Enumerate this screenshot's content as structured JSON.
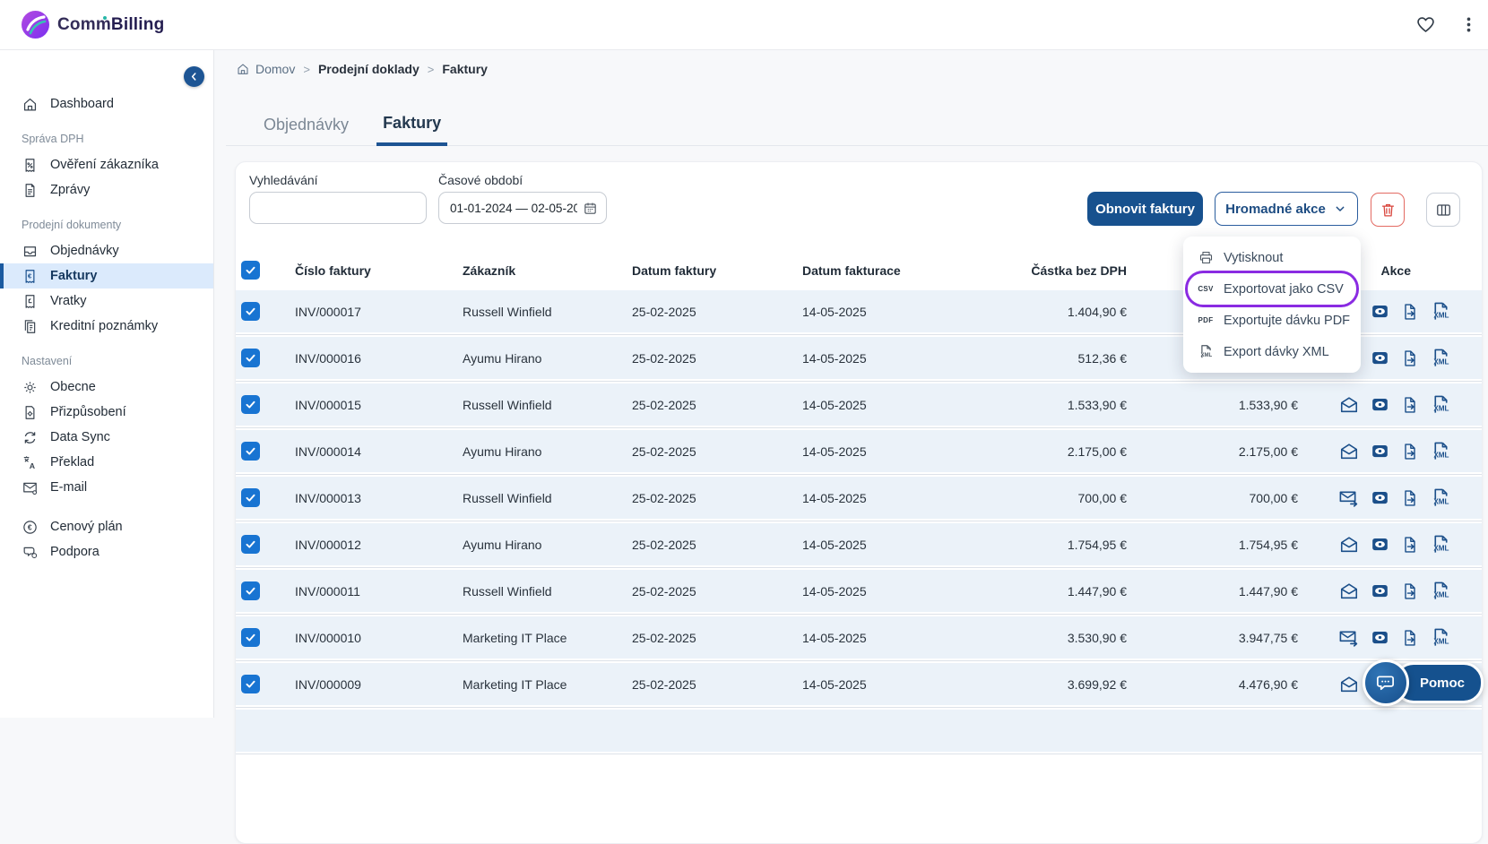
{
  "colors": {
    "primary": "#17518E",
    "highlight_purple": "#8A2BE2",
    "row_bg": "#EBF2F9",
    "checkbox_blue": "#1874D2",
    "danger_red": "#D8453C",
    "active_item_bg": "#DBEAFC",
    "icon_navy": "#1B4F8A"
  },
  "topbar": {
    "brand_comm": "Comm",
    "brand_billing": "Billing"
  },
  "sidebar": {
    "groups": [
      {
        "items": [
          {
            "label": "Dashboard",
            "icon": "home-icon"
          }
        ]
      },
      {
        "label": "Správa DPH",
        "items": [
          {
            "label": "Ověření zákazníka",
            "icon": "receipt-percent-icon"
          },
          {
            "label": "Zprávy",
            "icon": "document-icon"
          }
        ]
      },
      {
        "label": "Prodejní dokumenty",
        "items": [
          {
            "label": "Objednávky",
            "icon": "inbox-icon"
          },
          {
            "label": "Faktury",
            "icon": "receipt-euro-icon",
            "active": true
          },
          {
            "label": "Vratky",
            "icon": "receipt-return-icon"
          },
          {
            "label": "Kreditní poznámky",
            "icon": "copy-icon"
          }
        ]
      },
      {
        "label": "Nastavení",
        "items": [
          {
            "label": "Obecne",
            "icon": "gear-icon"
          },
          {
            "label": "Přizpůsobení",
            "icon": "document-gear-icon"
          },
          {
            "label": "Data Sync",
            "icon": "sync-icon"
          },
          {
            "label": "Překlad",
            "icon": "translate-icon"
          },
          {
            "label": "E-mail",
            "icon": "mail-gear-icon"
          }
        ]
      },
      {
        "items": [
          {
            "label": "Cenový plán",
            "icon": "euro-circle-icon"
          },
          {
            "label": "Podpora",
            "icon": "support-icon"
          }
        ]
      }
    ]
  },
  "breadcrumb": {
    "items": [
      "Domov",
      "Prodejní doklady",
      "Faktury"
    ]
  },
  "tabs": [
    {
      "label": "Objednávky",
      "active": false
    },
    {
      "label": "Faktury",
      "active": true
    }
  ],
  "filters": {
    "search_label": "Vyhledávání",
    "search_value": "",
    "period_label": "Časové období",
    "period_value": "01-01-2024 — 02-05-202"
  },
  "actions": {
    "refresh_label": "Obnovit faktury",
    "bulk_label": "Hromadné akce"
  },
  "menu": {
    "items": [
      {
        "label": "Vytisknout",
        "icon": "printer-icon"
      },
      {
        "label": "Exportovat jako CSV",
        "icon": "csv-icon",
        "badge": "CSV",
        "highlighted": true
      },
      {
        "label": "Exportujte dávku PDF",
        "icon": "pdf-icon",
        "badge": "PDF"
      },
      {
        "label": "Export dávky XML",
        "icon": "xml-icon"
      }
    ]
  },
  "table": {
    "columns": [
      "Číslo faktury",
      "Zákazník",
      "Datum faktury",
      "Datum fakturace",
      "Částka bez DPH",
      "",
      "Akce"
    ],
    "rows": [
      {
        "num": "INV/000017",
        "customer": "Russell Winfield",
        "date1": "25-02-2025",
        "date2": "14-05-2025",
        "net": "1.404,90 €",
        "total": "",
        "mail": "none",
        "checked": true
      },
      {
        "num": "INV/000016",
        "customer": "Ayumu Hirano",
        "date1": "25-02-2025",
        "date2": "14-05-2025",
        "net": "512,36 €",
        "total": "",
        "mail": "none",
        "checked": true
      },
      {
        "num": "INV/000015",
        "customer": "Russell Winfield",
        "date1": "25-02-2025",
        "date2": "14-05-2025",
        "net": "1.533,90 €",
        "total": "1.533,90 €",
        "mail": "open",
        "checked": true
      },
      {
        "num": "INV/000014",
        "customer": "Ayumu Hirano",
        "date1": "25-02-2025",
        "date2": "14-05-2025",
        "net": "2.175,00 €",
        "total": "2.175,00 €",
        "mail": "open",
        "checked": true
      },
      {
        "num": "INV/000013",
        "customer": "Russell Winfield",
        "date1": "25-02-2025",
        "date2": "14-05-2025",
        "net": "700,00 €",
        "total": "700,00 €",
        "mail": "send",
        "checked": true
      },
      {
        "num": "INV/000012",
        "customer": "Ayumu Hirano",
        "date1": "25-02-2025",
        "date2": "14-05-2025",
        "net": "1.754,95 €",
        "total": "1.754,95 €",
        "mail": "open",
        "checked": true
      },
      {
        "num": "INV/000011",
        "customer": "Russell Winfield",
        "date1": "25-02-2025",
        "date2": "14-05-2025",
        "net": "1.447,90 €",
        "total": "1.447,90 €",
        "mail": "open",
        "checked": true
      },
      {
        "num": "INV/000010",
        "customer": "Marketing IT Place",
        "date1": "25-02-2025",
        "date2": "14-05-2025",
        "net": "3.530,90 €",
        "total": "3.947,75 €",
        "mail": "send",
        "checked": true
      },
      {
        "num": "INV/000009",
        "customer": "Marketing IT Place",
        "date1": "25-02-2025",
        "date2": "14-05-2025",
        "net": "3.699,92 €",
        "total": "4.476,90 €",
        "mail": "open",
        "checked": true
      }
    ],
    "row_action_icons": [
      "mail-icon",
      "view-icon",
      "export-file-icon",
      "xml-file-icon"
    ]
  },
  "help": {
    "label": "Pomoc"
  },
  "icons": {
    "heart-icon": "♡",
    "kebab-menu-icon": "⋮",
    "collapse-sidebar-icon": "‹",
    "search-icon": "🔍",
    "calendar-icon": "📅",
    "chevron-down-icon": "⌄",
    "trash-icon": "🗑",
    "columns-icon": "▥",
    "printer-icon": "⎙",
    "home-icon": "⌂",
    "chat-icon": "💬"
  }
}
